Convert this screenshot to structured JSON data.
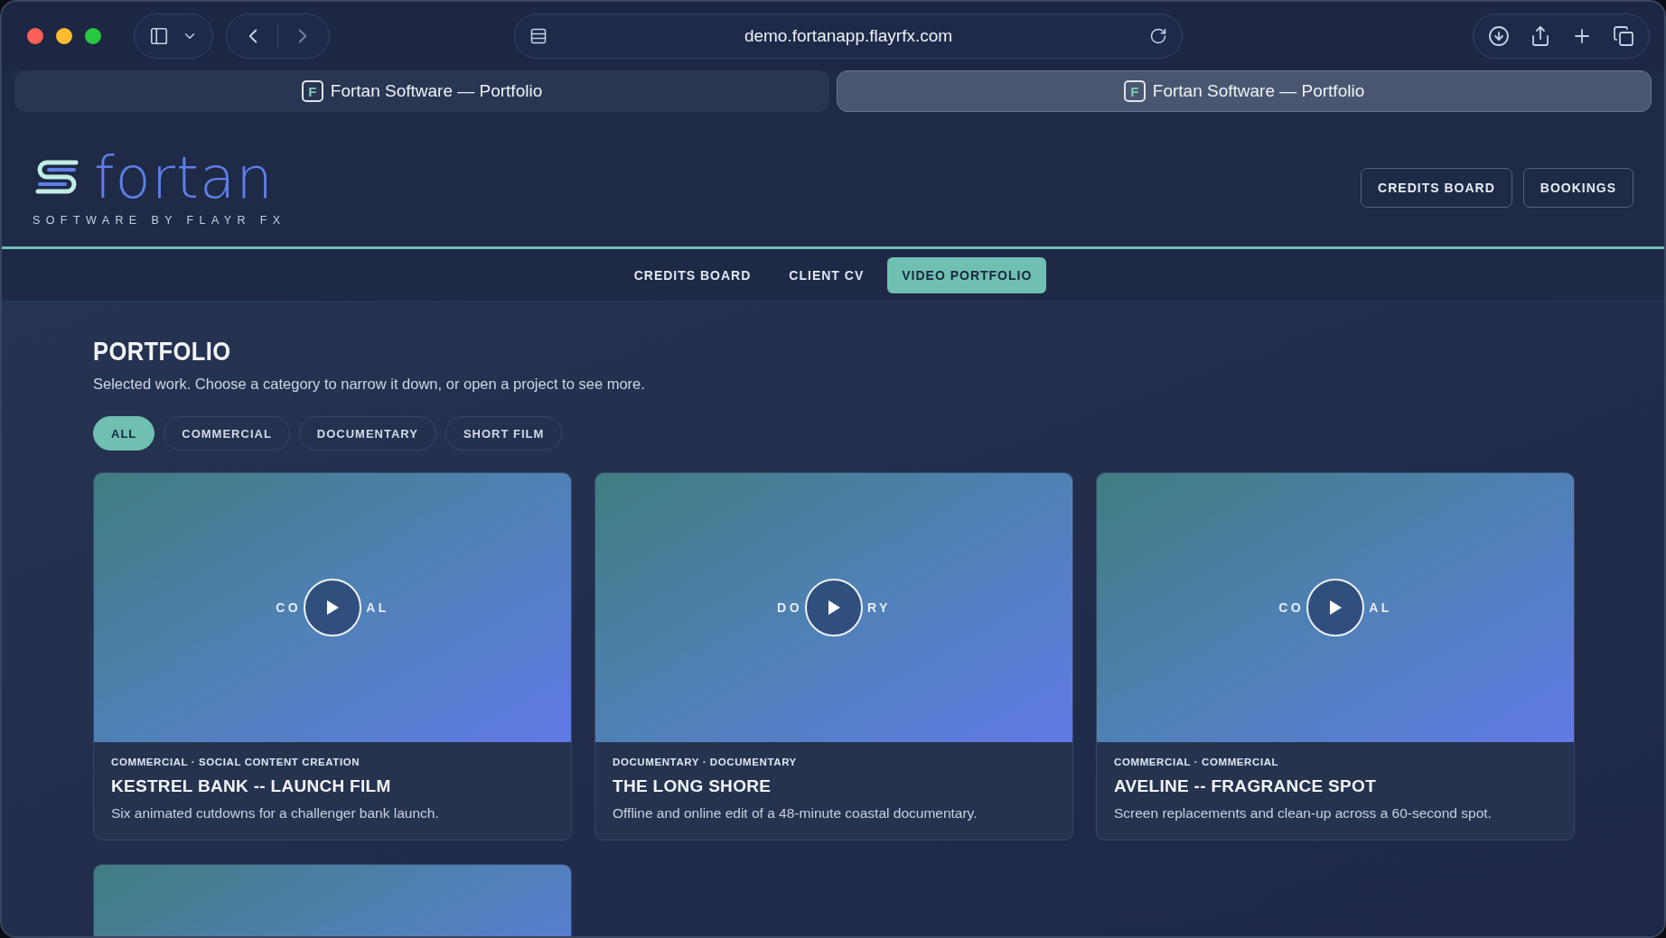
{
  "browser": {
    "url": "demo.fortanapp.flayrfx.com",
    "tabs": [
      {
        "icon_letter": "F",
        "title": "Fortan Software — Portfolio",
        "selected": false
      },
      {
        "icon_letter": "F",
        "title": "Fortan Software — Portfolio",
        "selected": true
      }
    ]
  },
  "header": {
    "logo": {
      "name": "fortan",
      "tagline": "SOFTWARE BY FLAYR FX"
    },
    "buttons": [
      "CREDITS BOARD",
      "BOOKINGS"
    ]
  },
  "nav": [
    {
      "label": "CREDITS BOARD",
      "selected": false
    },
    {
      "label": "CLIENT CV",
      "selected": false
    },
    {
      "label": "VIDEO PORTFOLIO",
      "selected": true
    }
  ],
  "page": {
    "title": "PORTFOLIO",
    "subtitle": "Selected work. Choose a category to narrow it down, or open a project to see more.",
    "filters": [
      {
        "label": "ALL",
        "selected": true
      },
      {
        "label": "COMMERCIAL",
        "selected": false
      },
      {
        "label": "DOCUMENTARY",
        "selected": false
      },
      {
        "label": "SHORT FILM",
        "selected": false
      }
    ],
    "cards": [
      {
        "kind": "full",
        "thumbnail_label_start": "CO",
        "thumbnail_label_end": "AL",
        "meta": "COMMERCIAL · SOCIAL CONTENT CREATION",
        "title": "KESTREL BANK -- LAUNCH FILM",
        "description": "Six animated cutdowns for a challenger bank launch."
      },
      {
        "kind": "full",
        "thumbnail_label_start": "DO",
        "thumbnail_label_end": "RY",
        "meta": "DOCUMENTARY · DOCUMENTARY",
        "title": "THE LONG SHORE",
        "description": "Offline and online edit of a 48-minute coastal documentary."
      },
      {
        "kind": "full",
        "thumbnail_label_start": "CO",
        "thumbnail_label_end": "AL",
        "meta": "COMMERCIAL · COMMERCIAL",
        "title": "AVELINE -- FRAGRANCE SPOT",
        "description": "Screen replacements and clean-up across a 60-second spot."
      },
      {
        "kind": "partial"
      }
    ]
  }
}
